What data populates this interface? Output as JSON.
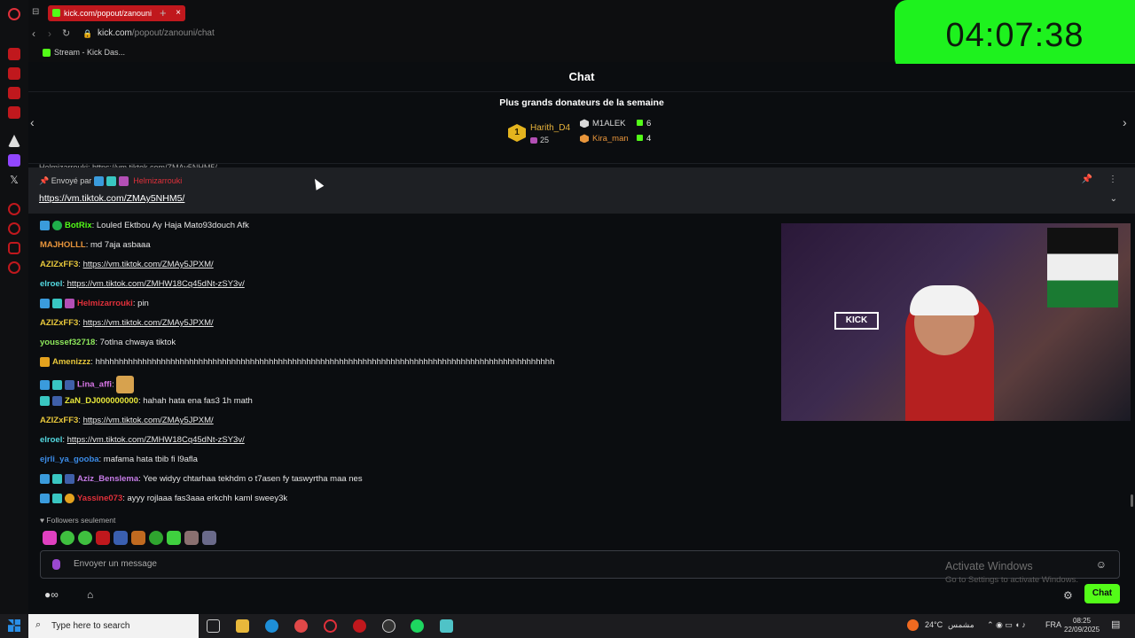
{
  "browser": {
    "tab_title": "kick.com/popout/zanouni",
    "tab_close": "×",
    "new_tab": "+",
    "url_host": "kick.com",
    "url_path": "/popout/zanouni/chat",
    "bookmark": "Stream - Kick Das..."
  },
  "timer": "04:07:38",
  "chat": {
    "header": "Chat",
    "donors_title": "Plus grands donateurs de la semaine",
    "top_donor": {
      "rank": "1",
      "name": "Harith_D4",
      "count": "25"
    },
    "donors": [
      {
        "name": "M1ALEK",
        "count": "6",
        "color": "#d9d9d9"
      },
      {
        "name": "Kira_man",
        "count": "4",
        "color": "#e8953b"
      }
    ],
    "pinned": {
      "by_label": "Envoyé par",
      "by_user": "Helmizarrouki",
      "link": "https://vm.tiktok.com/ZMAy5NHM5/",
      "partial": "Helmizarrouki: https://vm.tiktok.com/ZMAy5NHM5/"
    },
    "messages": [
      {
        "user": "BotRix",
        "color": "#53fc18",
        "text": ": Louled Ektbou Ay Haja Mato93douch Afk",
        "link": false
      },
      {
        "user": "MAJHOLLL",
        "color": "#e8953b",
        "text": ": md 7aja asbaaa",
        "link": false
      },
      {
        "user": "AZIZxFF3",
        "color": "#e8c83b",
        "text": "https://vm.tiktok.com/ZMAy5JPXM/",
        "link": true
      },
      {
        "user": "elroel",
        "color": "#53d8e0",
        "text": "https://vm.tiktok.com/ZMHW18Cq45dNt-zSY3v/",
        "link": true
      },
      {
        "user": "Helmizarrouki",
        "color": "#e0303a",
        "text": ": pin",
        "link": false
      },
      {
        "user": "AZIZxFF3",
        "color": "#e8c83b",
        "text": "https://vm.tiktok.com/ZMAy5JPXM/",
        "link": true
      },
      {
        "user": "youssef32718",
        "color": "#8ee85c",
        "text": ": 7otlna chwaya tiktok",
        "link": false
      },
      {
        "user": "Amenizzz",
        "color": "#e8c83b",
        "text": ": hhhhhhhhhhhhhhhhhhhhhhhhhhhhhhhhhhhhhhhhhhhhhhhhhhhhhhhhhhhhhhhhhhhhhhhhhhhhhhhhhhhhhhhhhhhhhhhhhh",
        "link": false
      },
      {
        "user": "Lina_affi",
        "color": "#d977e8",
        "text": ":",
        "link": false
      },
      {
        "user": "ZaN_DJ000000000",
        "color": "#e8e83b",
        "text": ": hahah hata ena fas3 1h math",
        "link": false
      },
      {
        "user": "AZIZxFF3",
        "color": "#e8c83b",
        "text": "https://vm.tiktok.com/ZMAy5JPXM/",
        "link": true
      },
      {
        "user": "elroel",
        "color": "#53d8e0",
        "text": "https://vm.tiktok.com/ZMHW18Cq45dNt-zSY3v/",
        "link": true
      },
      {
        "user": "ejrli_ya_gooba",
        "color": "#3b8ce8",
        "text": ": mafama hata tbib fi l9afla",
        "link": false
      },
      {
        "user": "Aziz_Benslema",
        "color": "#c77ce8",
        "text": ": Yee widyy chtarhaa tekhdm o t7asen fy taswyrtha maa nes",
        "link": false
      },
      {
        "user": "Yassine073",
        "color": "#e0303a",
        "text": ": ayyy rojlaaa fas3aaa erkchh kaml sweey3k",
        "link": false
      }
    ],
    "followers_only": "Followers seulement",
    "input_placeholder": "Envoyer un message",
    "chat_button": "Chat"
  },
  "windows_watermark": {
    "line1": "Activate Windows",
    "line2": "Go to Settings to activate Windows."
  },
  "taskbar": {
    "search": "Type here to search",
    "weather": "24°C",
    "weather_text": "مشمس",
    "lang": "FRA",
    "time": "08:25",
    "date": "22/09/2025"
  }
}
